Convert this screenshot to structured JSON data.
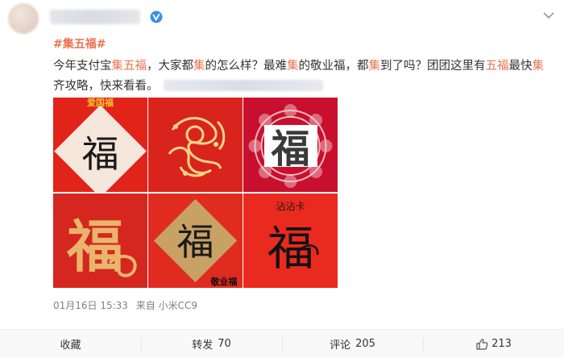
{
  "header": {
    "avatar": "avatar",
    "verified_icon": "verified-icon",
    "more_icon": "chevron-down-icon"
  },
  "post": {
    "hashtag": "#集五福#",
    "text_segments": [
      "今年支付宝",
      "集五福",
      "，大家都",
      "集",
      "的怎么样？最难",
      "集",
      "的敬业福，都",
      "集",
      "到了吗？团团这里有",
      "五福",
      "最快",
      "集",
      "齐攻略，快来看看。"
    ]
  },
  "images": [
    {
      "label": "爱国福"
    },
    {
      "label": ""
    },
    {
      "label": "福"
    },
    {
      "label": "福"
    },
    {
      "label": "福",
      "caption": "敬业福"
    },
    {
      "label": "福",
      "caption": "沾沾卡"
    }
  ],
  "meta": {
    "date": "01月16日 15:33",
    "source_prefix": "来自",
    "source": "小米CC9"
  },
  "actions": {
    "favorite": "收藏",
    "repost_label": "转发",
    "repost_count": "70",
    "comment_label": "评论",
    "comment_count": "205",
    "like_count": "213"
  },
  "colors": {
    "highlight": "#eb7350",
    "verified": "#3a93e4"
  }
}
